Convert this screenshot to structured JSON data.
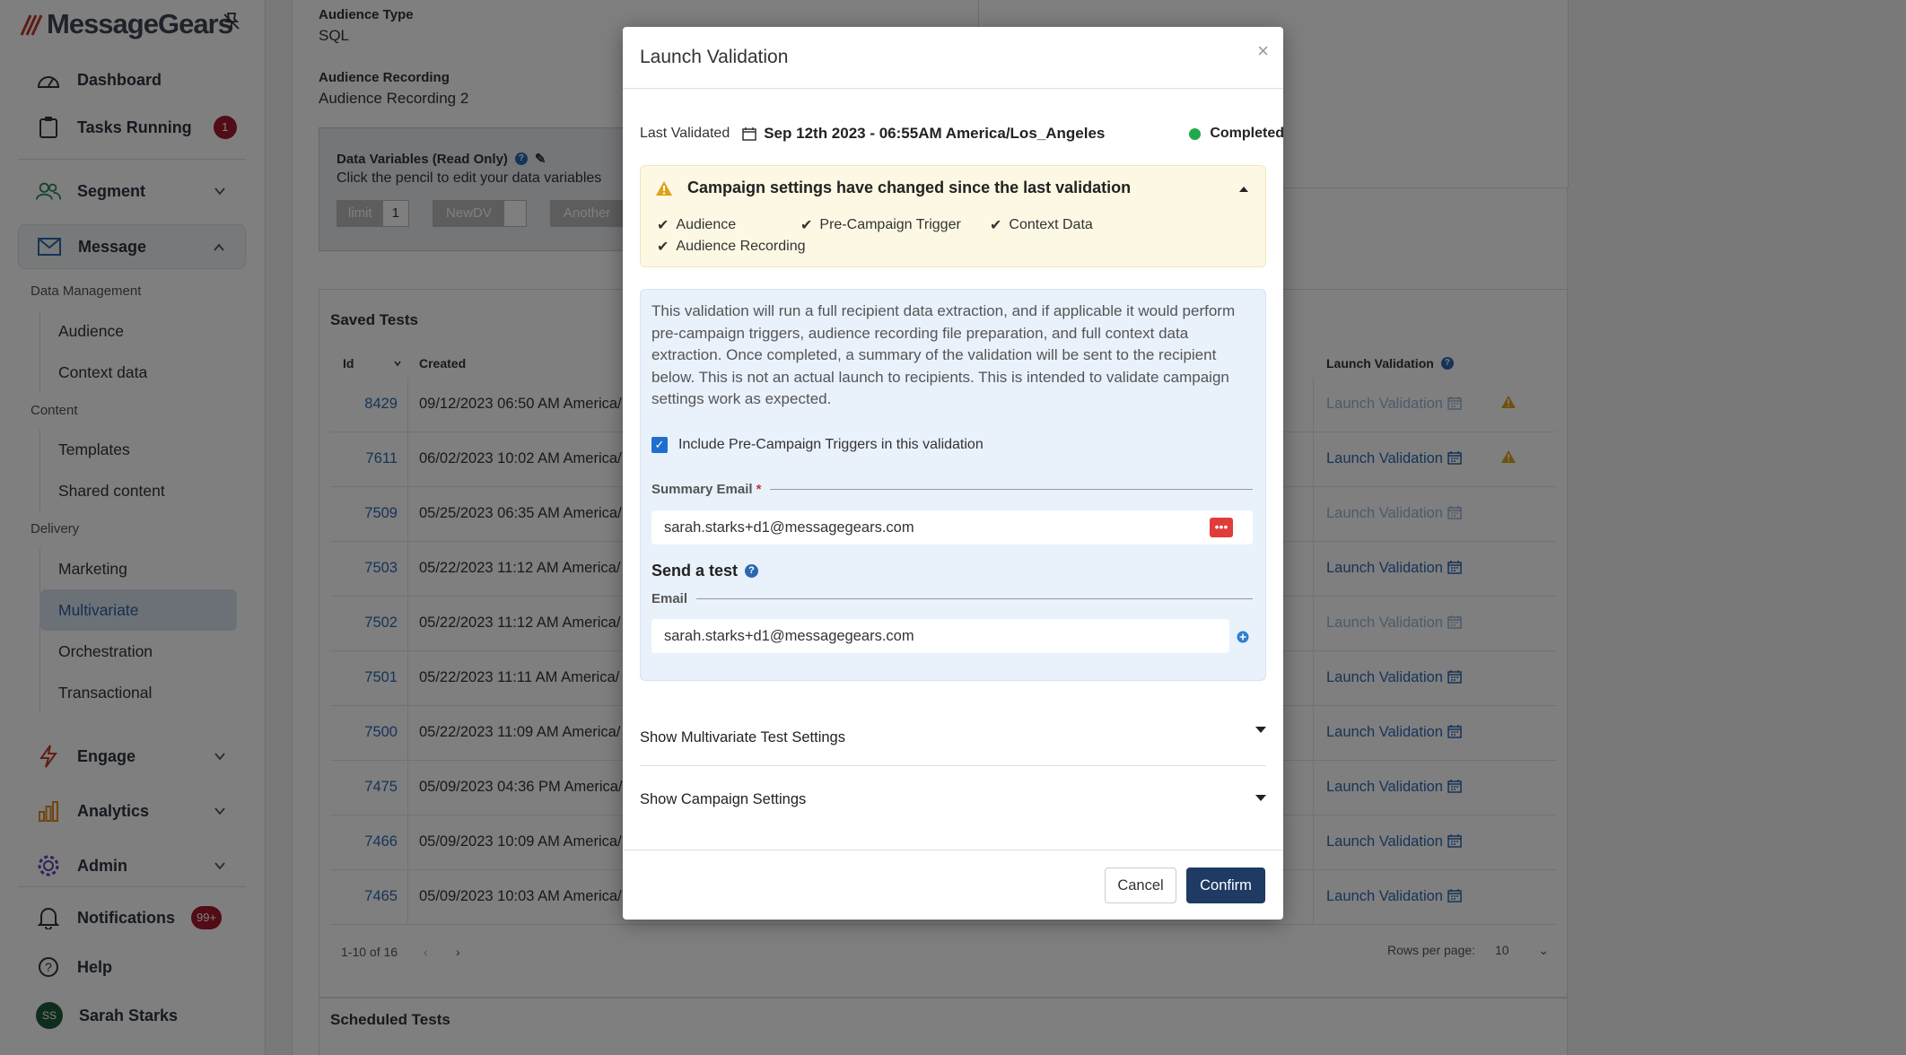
{
  "app": {
    "logo": "MessageGears"
  },
  "sidebar": {
    "dashboard": "Dashboard",
    "tasks_running": "Tasks Running",
    "tasks_badge": "1",
    "segment": "Segment",
    "message": "Message",
    "data_management": "Data Management",
    "audience": "Audience",
    "context_data": "Context data",
    "content": "Content",
    "templates": "Templates",
    "shared_content": "Shared content",
    "delivery": "Delivery",
    "marketing": "Marketing",
    "multivariate": "Multivariate",
    "orchestration": "Orchestration",
    "transactional": "Transactional",
    "engage": "Engage",
    "analytics": "Analytics",
    "admin": "Admin",
    "notifications": "Notifications",
    "notifications_badge": "99+",
    "help": "Help",
    "user_initials": "SS",
    "user_name": "Sarah Starks"
  },
  "page": {
    "audience_type_label": "Audience Type",
    "audience_type_value": "SQL",
    "audience_recording_label": "Audience Recording",
    "audience_recording_value": "Audience Recording 2",
    "data_vars_title": "Data Variables (Read Only)",
    "data_vars_hint": "Click the pencil to edit your data variables",
    "dv_limit_label": "limit",
    "dv_limit_value": "1",
    "dv_newdv_label": "NewDV",
    "dv_another_label": "Another",
    "saved_tests_title": "Saved Tests",
    "col_id": "Id",
    "col_created": "Created",
    "col_launch": "Launch Validation",
    "launch_link": "Launch Validation",
    "rows": [
      {
        "id": "8429",
        "created": "09/12/2023 06:50 AM America/",
        "enabled": false,
        "warn": true
      },
      {
        "id": "7611",
        "created": "06/02/2023 10:02 AM America/",
        "enabled": true,
        "warn": true
      },
      {
        "id": "7509",
        "created": "05/25/2023 06:35 AM America/",
        "enabled": false,
        "warn": false
      },
      {
        "id": "7503",
        "created": "05/22/2023 11:12 AM America/",
        "enabled": true,
        "warn": false
      },
      {
        "id": "7502",
        "created": "05/22/2023 11:12 AM America/",
        "enabled": false,
        "warn": false
      },
      {
        "id": "7501",
        "created": "05/22/2023 11:11 AM America/",
        "enabled": true,
        "warn": false
      },
      {
        "id": "7500",
        "created": "05/22/2023 11:09 AM America/",
        "enabled": true,
        "warn": false
      },
      {
        "id": "7475",
        "created": "05/09/2023 04:36 PM America/",
        "enabled": true,
        "warn": false
      },
      {
        "id": "7466",
        "created": "05/09/2023 10:09 AM America/",
        "enabled": true,
        "warn": false
      },
      {
        "id": "7465",
        "created": "05/09/2023 10:03 AM America/",
        "enabled": true,
        "warn": false
      }
    ],
    "pagination": "1-10 of 16",
    "rows_per_page_label": "Rows per page:",
    "rows_per_page_value": "10",
    "scheduled_tests_title": "Scheduled Tests"
  },
  "modal": {
    "title": "Launch Validation",
    "close": "×",
    "last_validated_label": "Last Validated",
    "last_validated_value": "Sep 12th 2023 - 06:55AM America/Los_Angeles",
    "status": "Completed",
    "status_color": "#22a84a",
    "warning_title": "Campaign settings have changed since the last validation",
    "changes": [
      "Audience",
      "Pre-Campaign Trigger",
      "Context Data",
      "Audience Recording"
    ],
    "info_text": "This validation will run a full recipient data extraction, and if applicable it would perform pre-campaign triggers, audience recording file preparation, and full context data extraction. Once completed, a summary of the validation will be sent to the recipient below. This is not an actual launch to recipients. This is intended to validate campaign settings work as expected.",
    "include_triggers_label": "Include Pre-Campaign Triggers in this validation",
    "include_triggers_checked": true,
    "summary_email_label": "Summary Email",
    "required_mark": "*",
    "summary_email_value": "sarah.starks+d1@messagegears.com",
    "send_test_title": "Send a test",
    "email_label": "Email",
    "email_value": "sarah.starks+d1@messagegears.com",
    "show_mv_settings": "Show Multivariate Test Settings",
    "show_campaign_settings": "Show Campaign Settings",
    "cancel": "Cancel",
    "confirm": "Confirm"
  },
  "colors": {
    "brand_navy": "#1f3a63",
    "link": "#2c68b0",
    "badge": "#a3182b",
    "warning": "#e0a21b"
  }
}
